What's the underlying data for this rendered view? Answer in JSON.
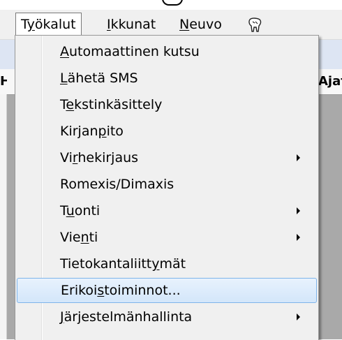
{
  "background": {
    "grid_left_header": "H",
    "grid_right_header": "Ajat"
  },
  "menubar": {
    "items": [
      {
        "pre": "T",
        "u": "y",
        "post": "ökalut"
      },
      {
        "pre": "",
        "u": "I",
        "post": "kkunat"
      },
      {
        "pre": "",
        "u": "N",
        "post": "euvo"
      }
    ],
    "help_icon": "tooth-icon"
  },
  "menu": {
    "items": [
      {
        "pre": "",
        "u": "A",
        "post": "utomaattinen kutsu",
        "submenu": false
      },
      {
        "pre": "",
        "u": "L",
        "post": "ähetä SMS",
        "submenu": false
      },
      {
        "pre": "T",
        "u": "e",
        "post": "kstinkäsittely",
        "submenu": false
      },
      {
        "pre": "Kirjan",
        "u": "p",
        "post": "ito",
        "submenu": false
      },
      {
        "pre": "Vi",
        "u": "r",
        "post": "hekirjaus",
        "submenu": true
      },
      {
        "pre": "Romexis/Dimaxis",
        "u": "",
        "post": "",
        "submenu": false
      },
      {
        "pre": "T",
        "u": "u",
        "post": "onti",
        "submenu": true
      },
      {
        "pre": "Vie",
        "u": "n",
        "post": "ti",
        "submenu": true
      },
      {
        "pre": "Tietokantaliitt",
        "u": "y",
        "post": "mät",
        "submenu": false
      },
      {
        "pre": "Erikoi",
        "u": "s",
        "post": "toiminnot...",
        "submenu": false
      },
      {
        "pre": "",
        "u": "J",
        "post": "ärjestelmänhallinta",
        "submenu": true
      }
    ],
    "highlighted_index": 9
  },
  "colors": {
    "highlight_bg": "#d3e6fa",
    "highlight_border": "#7eb4ea",
    "menu_bg": "#f0f0f0",
    "grid_bg": "#a9a9a9"
  }
}
